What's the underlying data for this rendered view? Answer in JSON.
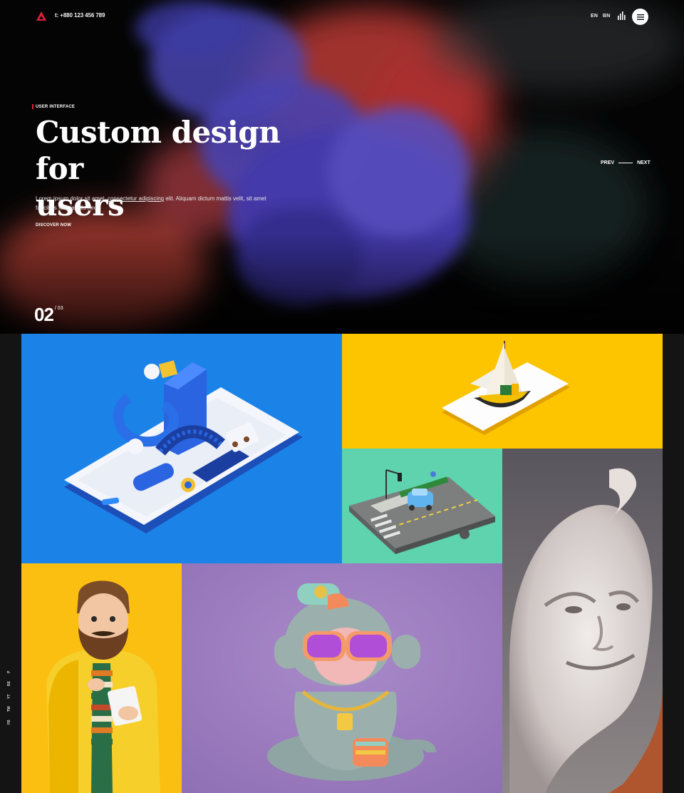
{
  "header": {
    "phone": "t: +880 123 456 789",
    "languages": [
      "EN",
      "BN"
    ],
    "logo_icon": "triangle-logo-icon",
    "stats_icon": "bar-chart-icon",
    "menu_icon": "hamburger-menu-icon"
  },
  "hero": {
    "tag": "USER INTERFACE",
    "title_line1": "Custom design for",
    "title_line2": "users",
    "text_before": "Lorem ipsum dolor sit amet, ",
    "text_link": "consectetur adipiscing",
    "text_after": " elit. Aliquam dictum mattis velit, sit amet faucibus felis iaculis nec.",
    "cta": "DISCOVER NOW",
    "prev": "PREV",
    "next": "NEXT",
    "current": "02",
    "total": "/ 03"
  },
  "social": [
    "FB",
    "TW",
    "YT",
    "BE",
    "P"
  ],
  "colors": {
    "accent": "#e0213a",
    "tile_blue": "#1b83e8",
    "tile_yellow": "#fdc400",
    "tile_mint": "#5ed3ad",
    "tile_grey": "#b4b0b4",
    "tile_gold": "#fbbf12",
    "tile_purple": "#9c7bc0"
  }
}
